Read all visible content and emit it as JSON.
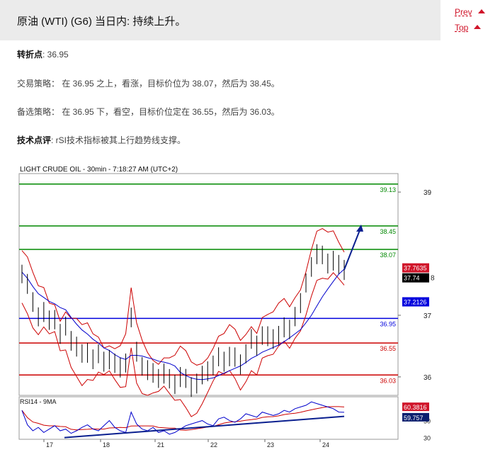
{
  "header": {
    "title": "原油 (WTI) (G6) 当日内: 持续上升。"
  },
  "nav": {
    "prev": "Prev",
    "top": "Top"
  },
  "analysis": {
    "pivot_label": "转折点",
    "pivot_value": ": 36.95",
    "strategy_label": "交易策略：",
    "strategy_text": " 在 36.95 之上，看涨，目标价位为 38.07，然后为 38.45。",
    "alt_label": "备选策略：",
    "alt_text": " 在 36.95 下，看空，目标价位定在 36.55，然后为 36.03。",
    "comment_label": "技术点评",
    "comment_text": ": rSI技术指标被其上行趋势线支撑。"
  },
  "colors": {
    "accent_red": "#d0152a",
    "support_blue": "#0000dd",
    "target_green": "#008800",
    "band_red": "#cc0000"
  },
  "chart_data": [
    {
      "type": "candlestick",
      "title": "LIGHT CRUDE OIL - 30min - 7:18:27 AM (UTC+2)",
      "x_ticks": [
        "17",
        "18",
        "21",
        "22",
        "23",
        "24"
      ],
      "y_ticks": [
        36,
        37,
        39
      ],
      "y_tick_label_partial": "8",
      "ylim": [
        35.7,
        39.3
      ],
      "price_path": [
        37.7,
        37.5,
        37.2,
        37.0,
        37.05,
        36.9,
        36.95,
        36.7,
        36.8,
        36.6,
        36.5,
        36.35,
        36.4,
        36.3,
        36.35,
        36.25,
        36.3,
        36.2,
        36.15,
        36.25,
        36.95,
        36.4,
        36.2,
        36.1,
        36.05,
        36.0,
        36.05,
        35.95,
        35.9,
        36.0,
        35.95,
        35.85,
        35.9,
        36.0,
        36.1,
        36.2,
        36.3,
        36.25,
        36.35,
        36.3,
        36.2,
        36.4,
        36.6,
        36.5,
        36.7,
        36.65,
        36.6,
        36.7,
        36.8,
        36.75,
        37.0,
        37.2,
        37.5,
        37.8,
        38.0,
        37.95,
        37.85,
        37.9,
        37.8,
        37.74
      ],
      "levels": [
        {
          "label": "39.13",
          "value": 39.13,
          "kind": "target"
        },
        {
          "label": "38.45",
          "value": 38.45,
          "kind": "target"
        },
        {
          "label": "38.07",
          "value": 38.07,
          "kind": "target"
        },
        {
          "label": "36.95",
          "value": 36.95,
          "kind": "pivot"
        },
        {
          "label": "36.55",
          "value": 36.55,
          "kind": "support"
        },
        {
          "label": "36.03",
          "value": 36.03,
          "kind": "support"
        }
      ],
      "price_tags": [
        {
          "label": "37.7635",
          "value": 37.7635,
          "color": "#d0152a"
        },
        {
          "label": "37.74",
          "value": 37.74,
          "color": "#000000"
        },
        {
          "label": "37.2126",
          "value": 37.2126,
          "color": "#0000dd"
        }
      ],
      "forecast_arrow": {
        "from": 37.74,
        "to": 38.45
      }
    },
    {
      "type": "line",
      "title": "RSI14 - 9MA",
      "y_ticks": [
        30,
        50
      ],
      "ylim": [
        28,
        78
      ],
      "rsi_path": [
        62,
        45,
        38,
        42,
        36,
        40,
        44,
        38,
        40,
        35,
        38,
        42,
        45,
        40,
        38,
        44,
        50,
        42,
        38,
        36,
        60,
        46,
        40,
        38,
        42,
        36,
        38,
        34,
        36,
        40,
        44,
        46,
        48,
        50,
        46,
        44,
        52,
        54,
        50,
        48,
        52,
        58,
        56,
        54,
        60,
        58,
        56,
        58,
        62,
        60,
        64,
        66,
        68,
        72,
        70,
        68,
        66,
        64,
        60,
        59.757
      ],
      "trendline": {
        "from": 30,
        "to": 55
      },
      "price_tags": [
        {
          "label": "60.3816",
          "value": 60.3816,
          "color": "#d0152a"
        },
        {
          "label": "59.757",
          "value": 59.757,
          "color": "#0a1f6e"
        }
      ]
    }
  ]
}
